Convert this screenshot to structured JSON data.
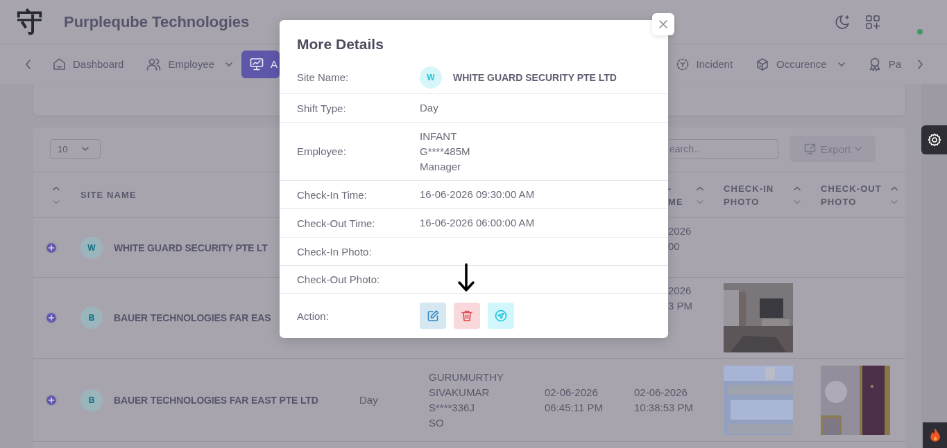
{
  "app": {
    "logo": "守",
    "title": "Purpleqube Technologies"
  },
  "nav": {
    "items": [
      {
        "label": "Dashboard",
        "dropdown": false,
        "selected": false
      },
      {
        "label": "Employee",
        "dropdown": true,
        "selected": false
      },
      {
        "label": "A",
        "dropdown": false,
        "selected": true
      },
      {
        "label": "Incident",
        "dropdown": false,
        "selected": false
      },
      {
        "label": "Occurence",
        "dropdown": true,
        "selected": false
      },
      {
        "label": "Pa",
        "dropdown": false,
        "selected": false
      }
    ]
  },
  "table": {
    "page_size": "10",
    "search": {
      "placeholder": "earch.."
    },
    "export": "Export",
    "columns": [
      {
        "label": "SITE NAME"
      },
      {
        "label": "- ME"
      },
      {
        "label": "CHECK-IN PHOTO"
      },
      {
        "label": "CHECK-OUT PHOTO"
      }
    ],
    "rows": [
      {
        "expanded": false,
        "avatar": "W",
        "site_name": "WHITE GUARD SECURITY PTE LT",
        "check_out_time": [
          "2026",
          "00"
        ]
      },
      {
        "expanded": false,
        "avatar": "B",
        "site_name": "BAUER TECHNOLOGIES FAR EAS",
        "check_out_time": [
          "2026",
          "3 PM"
        ],
        "check_in_photo": {
          "kind": "picture"
        }
      },
      {
        "expanded": false,
        "avatar": "B",
        "site_name": "BAUER TECHNOLOGIES FAR EAST PTE LTD",
        "shift_type": "Day",
        "employee": [
          "GURUMURTHY",
          "SIVAKUMAR",
          "S****336J",
          "SO"
        ],
        "check_in_time": [
          "02-06-2026",
          "06:45:11 PM"
        ],
        "check_out_time": [
          "02-06-2026",
          "10:38:53 PM"
        ],
        "check_in_photo": {
          "kind": "picture"
        },
        "check_out_photo": {
          "kind": "picture"
        }
      }
    ]
  },
  "modal": {
    "title": "More Details",
    "rows": [
      {
        "kind": "site",
        "label": "Site Name:",
        "avatar": "W",
        "value": "WHITE GUARD SECURITY PTE LTD"
      },
      {
        "kind": "text",
        "label": "Shift Type:",
        "lines": [
          "Day"
        ]
      },
      {
        "kind": "text",
        "label": "Employee:",
        "lines": [
          "INFANT",
          "G****485M",
          "Manager"
        ]
      },
      {
        "kind": "text",
        "label": "Check-In Time:",
        "lines": [
          "16-06-2026 09:30:00 AM"
        ]
      },
      {
        "kind": "text",
        "label": "Check-Out Time:",
        "lines": [
          "16-06-2026 06:00:00 AM"
        ]
      },
      {
        "kind": "empty",
        "label": "Check-In Photo:"
      },
      {
        "kind": "empty",
        "label": "Check-Out Photo:"
      },
      {
        "kind": "actions",
        "label": "Action:",
        "actions": [
          {
            "kind": "edit"
          },
          {
            "kind": "delete"
          },
          {
            "kind": "send"
          }
        ]
      }
    ]
  }
}
